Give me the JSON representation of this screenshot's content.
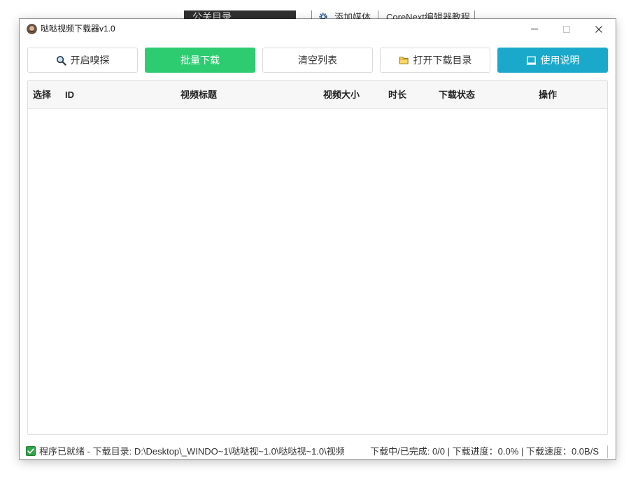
{
  "background_window": {
    "dark_tab_label": "公关目录",
    "gear_icon": "gear-icon",
    "add_media_label": "添加媒体",
    "tutorial_label": "CoreNext编辑器教程"
  },
  "window": {
    "app_icon": "app-logo-icon",
    "title": "哒哒视频下载器v1.0",
    "controls": {
      "minimize_icon": "minimize-icon",
      "maximize_icon": "maximize-icon",
      "close_icon": "close-icon",
      "maximize_enabled": false
    }
  },
  "toolbar": {
    "buttons": [
      {
        "label": "开启嗅探",
        "icon": "search-icon",
        "bg": "#ffffff",
        "fg": "#333333",
        "border": "#dadada"
      },
      {
        "label": "批量下载",
        "bg": "#2ecc71",
        "fg": "#ffffff",
        "border": "#2ecc71"
      },
      {
        "label": "清空列表",
        "bg": "#ffffff",
        "fg": "#333333",
        "border": "#dadada"
      },
      {
        "label": "打开下载目录",
        "icon": "folder-icon",
        "bg": "#ffffff",
        "fg": "#333333",
        "border": "#dadada"
      },
      {
        "label": "使用说明",
        "icon": "book-icon",
        "bg": "#1ba9cb",
        "fg": "#ffffff",
        "border": "#1ba9cb"
      }
    ]
  },
  "table": {
    "columns": [
      "选择",
      "ID",
      "视频标题",
      "视频大小",
      "时长",
      "下载状态",
      "操作"
    ],
    "header_bg": "#f7f7f7",
    "rows": []
  },
  "status_bar": {
    "icon": "checkbox-checked-icon",
    "ready_text": "程序已就绪",
    "dash": "-",
    "download_dir_label": "下载目录:",
    "download_dir_path": "D:\\Desktop\\_WINDO~1\\哒哒视~1.0\\哒哒视~1.0\\视频",
    "downloaded_label": "下载中/已完成:",
    "downloaded_value": "0/0",
    "separator": "|",
    "progress_label": "下载进度：",
    "progress_value": "0.0%",
    "speed_label": "下载速度：",
    "speed_value": "0.0B/S"
  }
}
